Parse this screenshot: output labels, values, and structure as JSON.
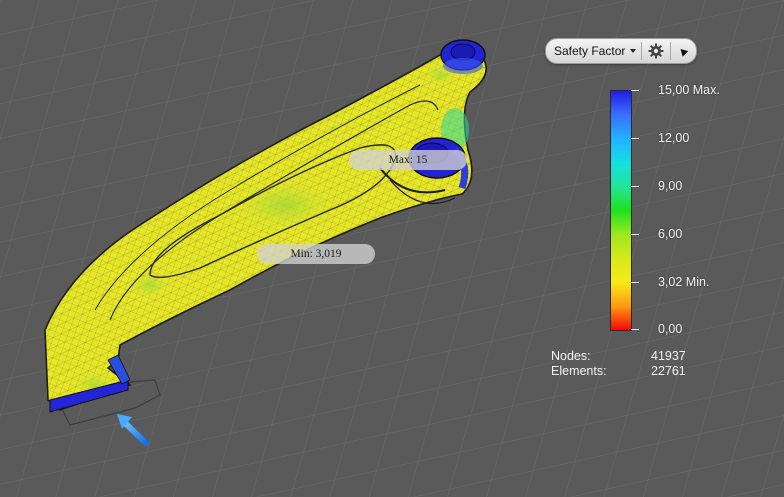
{
  "toolbar": {
    "result_type": "Safety Factor",
    "settings_icon": "gear-icon",
    "collapse_icon": "triangle-up-icon"
  },
  "legend": {
    "labels": [
      "15,00 Max.",
      "12,00",
      "9,00",
      "6,00",
      "3,02 Min.",
      "0,00"
    ]
  },
  "stats": {
    "nodes_label": "Nodes:",
    "nodes_value": "41937",
    "elements_label": "Elements:",
    "elements_value": "22761"
  },
  "probes": {
    "max_label": "Max: 15",
    "min_label": "Min: 3,019"
  },
  "colors": {
    "background": "#5a5a5a",
    "grid_line": "#6c6c6c",
    "part_yellow": "#e8e82a",
    "part_blue": "#2323d6",
    "arrow_blue": "#1e88ff"
  }
}
